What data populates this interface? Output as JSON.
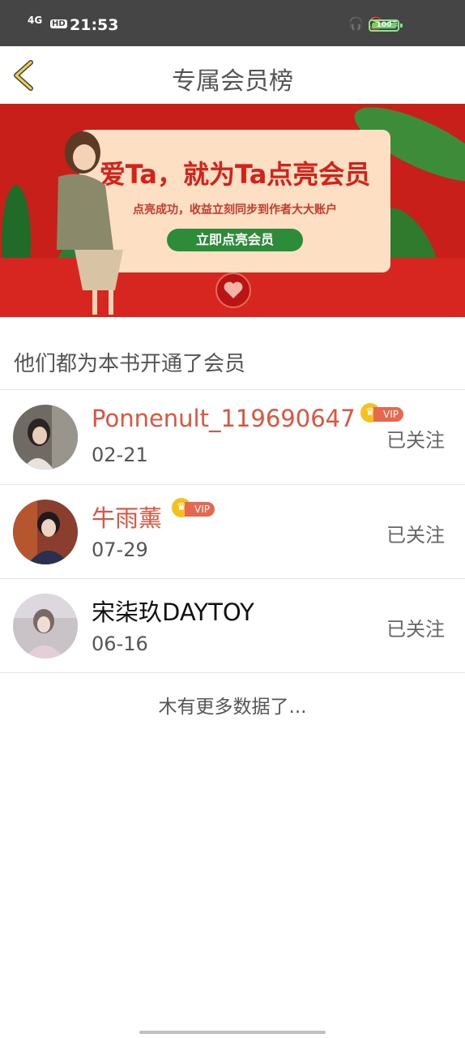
{
  "status_bar": {
    "network": "4G",
    "hd": "HD",
    "time": "21:53",
    "battery_label": "100"
  },
  "header": {
    "title": "专属会员榜"
  },
  "banner": {
    "headline": "爱Ta，就为Ta点亮会员",
    "subline": "点亮成功，收益立刻同步到作者大大账户",
    "button_label": "立即点亮会员"
  },
  "section": {
    "title": "他们都为本书开通了会员"
  },
  "members": [
    {
      "name": "Ponnenult_119690647",
      "date": "02-21",
      "follow_label": "已关注",
      "vip": true,
      "vip_label": "VIP",
      "name_color": "#e0533c"
    },
    {
      "name": "牛雨薰",
      "date": "07-29",
      "follow_label": "已关注",
      "vip": true,
      "vip_label": "VIP",
      "name_color": "#e0533c"
    },
    {
      "name": "宋柒玖DAYTOY",
      "date": "06-16",
      "follow_label": "已关注",
      "vip": false,
      "name_color": "#111111"
    }
  ],
  "footer": {
    "no_more": "木有更多数据了..."
  },
  "colors": {
    "accent": "#e0533c",
    "banner_red": "#c81f1b",
    "button_green": "#2e8b3a",
    "vip_gold": "#f4c21f"
  }
}
